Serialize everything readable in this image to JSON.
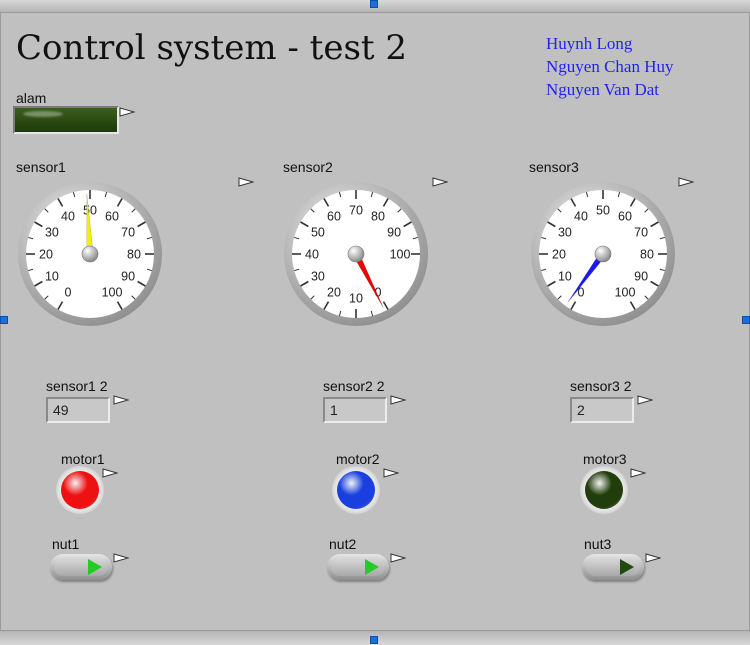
{
  "title": "Control system - test 2",
  "authors": [
    "Huynh Long",
    "Nguyen Chan Huy",
    "Nguyen Van Dat"
  ],
  "alarm": {
    "label": "alam",
    "color": "#2b4a12"
  },
  "gauges": [
    {
      "label": "sensor1",
      "value": 49,
      "needle_color": "#f2f200",
      "ticks": [
        "0",
        "10",
        "20",
        "30",
        "40",
        "50",
        "60",
        "70",
        "80",
        "90",
        "100"
      ]
    },
    {
      "label": "sensor2",
      "value": 1,
      "needle_color": "#ee0000",
      "ticks": [
        "0",
        "10",
        "20",
        "30",
        "40",
        "50",
        "60",
        "70",
        "80",
        "90",
        "100"
      ]
    },
    {
      "label": "sensor3",
      "value": 2,
      "needle_color": "#1a1aee",
      "ticks": [
        "0",
        "10",
        "20",
        "30",
        "40",
        "50",
        "60",
        "70",
        "80",
        "90",
        "100"
      ]
    }
  ],
  "indicators": [
    {
      "label": "sensor1 2",
      "value": "49"
    },
    {
      "label": "sensor2 2",
      "value": "1"
    },
    {
      "label": "sensor3 2",
      "value": "2"
    }
  ],
  "motors": [
    {
      "label": "motor1",
      "color": "#ee1111"
    },
    {
      "label": "motor2",
      "color": "#1a3fe0"
    },
    {
      "label": "motor3",
      "color": "#223d0c"
    }
  ],
  "buttons": [
    {
      "label": "nut1",
      "arrow_color": "#22cc22"
    },
    {
      "label": "nut2",
      "arrow_color": "#22cc22"
    },
    {
      "label": "nut3",
      "arrow_color": "#1f4a10"
    }
  ]
}
